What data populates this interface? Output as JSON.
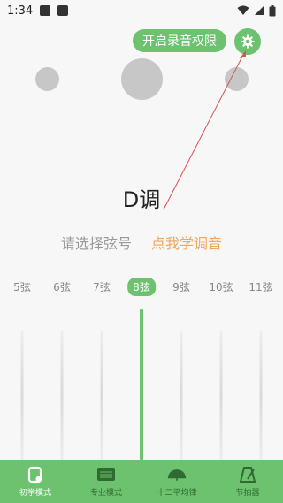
{
  "status_bar": {
    "time": "1:34"
  },
  "header": {
    "permission_button": "开启录音权限"
  },
  "tuner": {
    "key": "D调",
    "prompt": "请选择弦号",
    "tutorial_link": "点我学调音"
  },
  "strings": {
    "labels": [
      "5弦",
      "6弦",
      "7弦",
      "8弦",
      "9弦",
      "10弦",
      "11弦"
    ],
    "selected": "8弦"
  },
  "bottom_nav": {
    "items": [
      {
        "label": "初学模式",
        "icon": "beginner-mode-icon",
        "active": true
      },
      {
        "label": "专业模式",
        "icon": "pro-mode-icon",
        "active": false
      },
      {
        "label": "十二平均律",
        "icon": "twelve-tone-icon",
        "active": false
      },
      {
        "label": "节拍器",
        "icon": "metronome-icon",
        "active": false
      }
    ]
  },
  "colors": {
    "accent": "#6cc26e",
    "link": "#f1a75b",
    "arrow": "#d9534f"
  }
}
